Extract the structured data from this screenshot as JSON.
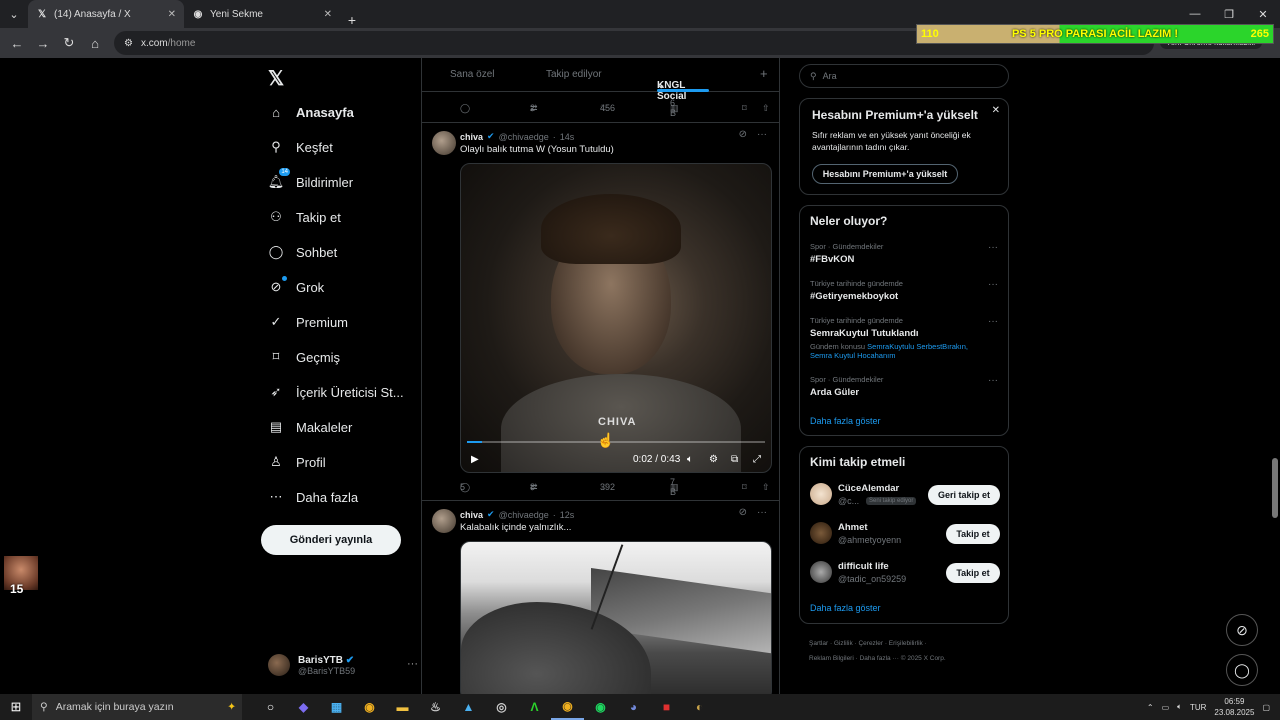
{
  "browser": {
    "tabs": [
      {
        "title": "(14) Anasayfa / X",
        "active": true
      },
      {
        "title": "Yeni Sekme",
        "active": false
      }
    ],
    "url_host": "x.com",
    "url_path": "/home",
    "profile_label": "Yeni Chrome kullanılabilir"
  },
  "overlay": {
    "left_value": "110",
    "message_a": "PS 5 PRO",
    "message_b": "PARASI ACİL LAZIM !",
    "right_value": "265"
  },
  "nav": {
    "items": [
      {
        "label": "Anasayfa",
        "icon": "home-icon"
      },
      {
        "label": "Keşfet",
        "icon": "search-icon"
      },
      {
        "label": "Bildirimler",
        "icon": "bell-icon",
        "badge": "14"
      },
      {
        "label": "Takip et",
        "icon": "add-person-icon"
      },
      {
        "label": "Sohbet",
        "icon": "chat-icon"
      },
      {
        "label": "Grok",
        "icon": "grok-icon"
      },
      {
        "label": "Premium",
        "icon": "verified-icon"
      },
      {
        "label": "Geçmiş",
        "icon": "bookmark-icon"
      },
      {
        "label": "İçerik Üreticisi St...",
        "icon": "rocket-icon"
      },
      {
        "label": "Makaleler",
        "icon": "article-icon"
      },
      {
        "label": "Profil",
        "icon": "person-icon"
      },
      {
        "label": "Daha fazla",
        "icon": "more-circle-icon"
      }
    ],
    "post_button": "Gönderi yayınla",
    "account": {
      "name": "BarisYTB",
      "handle": "@BarisYTB59"
    }
  },
  "feed": {
    "tabs": [
      {
        "label": "Sana özel"
      },
      {
        "label": "Takip edilyor"
      },
      {
        "label": "KNGL Social"
      }
    ],
    "top_actions": {
      "retweets": "2",
      "likes": "456",
      "views": "6 B"
    },
    "tweets": [
      {
        "name": "chiva",
        "handle": "@chivaedge",
        "time": "14s",
        "text": "Olaylı balık tutma W (Yosun Tutuldu)",
        "video": {
          "watermark": "CHIVA",
          "time": "0:02 / 0:43",
          "progress": 0.05
        },
        "actions": {
          "replies": "5",
          "retweets": "8",
          "likes": "392",
          "views": "7 B"
        }
      },
      {
        "name": "chiva",
        "handle": "@chivaedge",
        "time": "12s",
        "text": "Kalabalık içinde yalnızlık..."
      }
    ]
  },
  "right": {
    "search_placeholder": "Ara",
    "premium": {
      "title": "Hesabını Premium+'a yükselt",
      "desc": "Sıfır reklam ve en yüksek yanıt önceliği ek avantajlarının tadını çıkar.",
      "button": "Hesabını Premium+'a yükselt"
    },
    "trends": {
      "title": "Neler oluyor?",
      "items": [
        {
          "category": "Spor · Gündemdekiler",
          "topic": "#FBvKON"
        },
        {
          "category": "Türkiye tarihinde gündemde",
          "topic": "#Getiryemekboykot"
        },
        {
          "category": "Türkiye tarihinde gündemde",
          "topic": "SemraKuytul Tutuklandı",
          "sub_prefix": "Gündem konusu",
          "sub_links": "SemraKuytulu SerbestBırakın, Semra Kuytul Hocahanım"
        },
        {
          "category": "Spor · Gündemdekiler",
          "topic": "Arda Güler"
        }
      ],
      "show_more": "Daha fazla göster"
    },
    "who_to_follow": {
      "title": "Kimi takip etmeli",
      "items": [
        {
          "name": "CüceAlemdar",
          "handle": "@c...",
          "follows_you": "Seni takip ediyor",
          "button": "Geri takip et"
        },
        {
          "name": "Ahmet",
          "handle": "@ahmetyoyenn",
          "button": "Takip et"
        },
        {
          "name": "difficult life",
          "handle": "@tadic_on59259",
          "button": "Takip et"
        }
      ],
      "show_more": "Daha fazla göster"
    },
    "footer": {
      "line1": "Şartlar · Gizlilik · Çerezler · Erişilebilirlik ·",
      "line2": "Reklam Bilgileri · Daha fazla ··· © 2025 X Corp."
    }
  },
  "webcam_number": "15",
  "taskbar": {
    "search_placeholder": "Aramak için buraya yazın",
    "lang": "TUR",
    "time": "06:59",
    "date": "23.08.2025"
  }
}
